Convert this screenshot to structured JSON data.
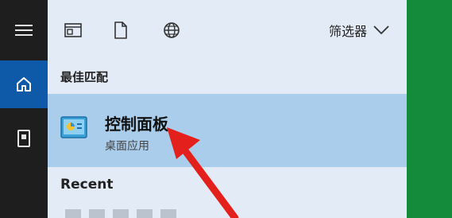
{
  "rail": {
    "menu_icon": "hamburger-icon",
    "home_icon": "home-icon",
    "docs_icon": "notebook-icon"
  },
  "toolbar": {
    "apps_icon": "app-window-icon",
    "documents_icon": "document-icon",
    "web_icon": "globe-icon",
    "filter_label": "筛选器",
    "filter_icon": "chevron-down-icon"
  },
  "results": {
    "best_match_label": "最佳匹配",
    "best_match": {
      "title": "控制面板",
      "subtitle": "桌面应用",
      "icon": "control-panel-icon"
    },
    "recent_label": "Recent"
  },
  "colors": {
    "rail": "#1e1e1e",
    "rail_active": "#0f5aa8",
    "panel": "#e3ebf6",
    "highlight": "#a9cdea",
    "annotation_arrow": "#e3201b"
  }
}
